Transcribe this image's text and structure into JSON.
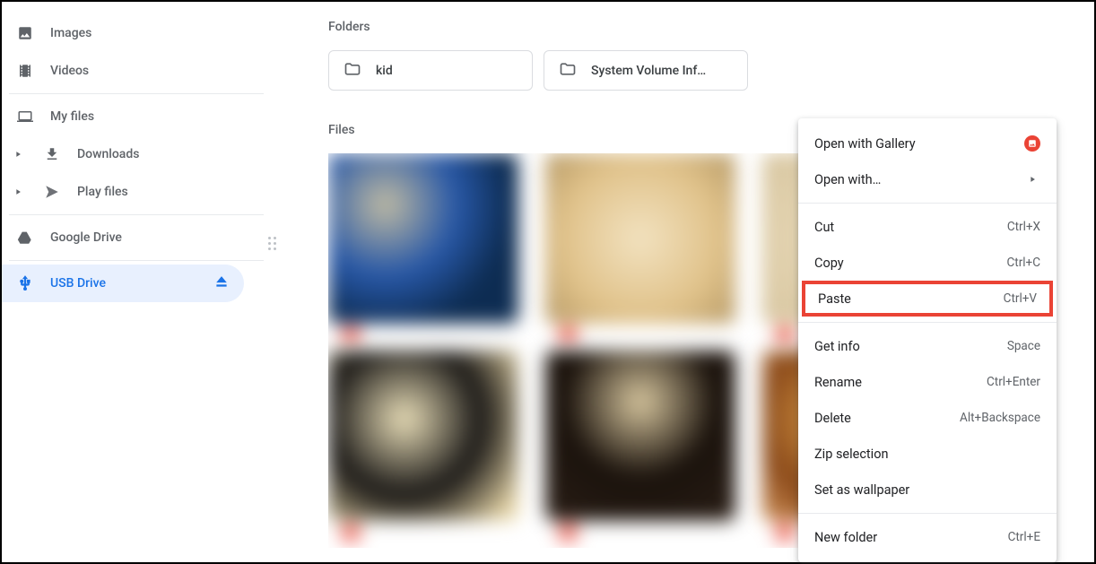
{
  "sidebar": {
    "images": "Images",
    "videos": "Videos",
    "myfiles": "My files",
    "downloads": "Downloads",
    "playfiles": "Play files",
    "gdrive": "Google Drive",
    "usb": "USB Drive"
  },
  "main": {
    "folders_label": "Folders",
    "files_label": "Files",
    "folders": [
      {
        "name": "kid"
      },
      {
        "name": "System Volume Inf…"
      }
    ]
  },
  "menu": {
    "open_gallery": "Open with Gallery",
    "open_with": "Open with…",
    "cut": "Cut",
    "cut_sc": "Ctrl+X",
    "copy": "Copy",
    "copy_sc": "Ctrl+C",
    "paste": "Paste",
    "paste_sc": "Ctrl+V",
    "getinfo": "Get info",
    "getinfo_sc": "Space",
    "rename": "Rename",
    "rename_sc": "Ctrl+Enter",
    "delete": "Delete",
    "delete_sc": "Alt+Backspace",
    "zip": "Zip selection",
    "wallpaper": "Set as wallpaper",
    "newfolder": "New folder",
    "newfolder_sc": "Ctrl+E"
  }
}
